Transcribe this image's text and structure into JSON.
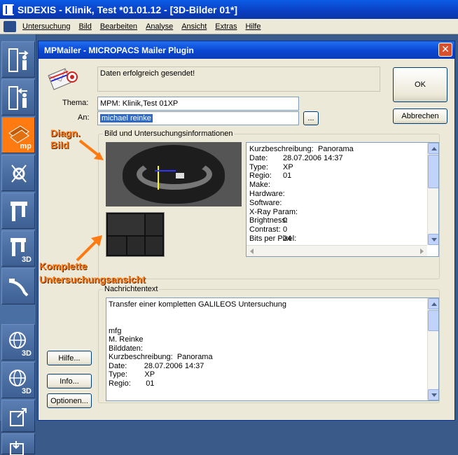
{
  "app": {
    "title": "SIDEXIS - Klinik, Test *01.01.12 - [3D-Bilder 01*]"
  },
  "menu": [
    "Untersuchung",
    "Bild",
    "Bearbeiten",
    "Analyse",
    "Ansicht",
    "Extras",
    "Hilfe"
  ],
  "toolbar": {
    "items": [
      {
        "icon": "door-exit-person-icon",
        "sub": ""
      },
      {
        "icon": "door-enter-person-icon",
        "sub": ""
      },
      {
        "icon": "mpmailer-icon",
        "sub": "mp"
      },
      {
        "icon": "tooth-measure-icon",
        "sub": ""
      },
      {
        "icon": "xray-unit-icon",
        "sub": ""
      },
      {
        "icon": "xray-unit-3d-icon",
        "sub": "3D"
      },
      {
        "icon": "intraoral-sensor-icon",
        "sub": ""
      },
      {
        "icon": "globe-3d-icon",
        "sub": "3D"
      },
      {
        "icon": "globe-3d-alt-icon",
        "sub": "3D"
      },
      {
        "icon": "export-icon",
        "sub": ""
      },
      {
        "icon": "import-icon",
        "sub": ""
      }
    ],
    "active_color": "#ff7a10"
  },
  "dialog": {
    "title": "MPMailer - MICROPACS Mailer Plugin",
    "status": "Daten erfolgreich gesendet!",
    "ok_label": "OK",
    "cancel_label": "Abbrechen",
    "thema_label": "Thema:",
    "thema_value": "MPM: Klinik,Test 01XP",
    "an_label": "An:",
    "an_value": "michael reinke",
    "browse_label": "...",
    "group_images_title": "Bild und Untersuchungsinformationen",
    "info": [
      {
        "k": "Kurzbeschreibung:",
        "v": "Panorama"
      },
      {
        "k": "Date:",
        "v": "28.07.2006 14:37"
      },
      {
        "k": "Type:",
        "v": "XP"
      },
      {
        "k": "Regio:",
        "v": "01"
      },
      {
        "k": "Make:",
        "v": ""
      },
      {
        "k": "Hardware:",
        "v": ""
      },
      {
        "k": "Software:",
        "v": ""
      },
      {
        "k": "X-Ray Param:",
        "v": ""
      },
      {
        "k": "Brightness:",
        "v": "0"
      },
      {
        "k": "Contrast:",
        "v": "0"
      },
      {
        "k": "Bits per Pixel:",
        "v": "24"
      }
    ],
    "group_message_title": "Nachrichtentext",
    "message_lines": [
      "Transfer einer kompletten GALILEOS Untersuchung",
      "",
      "",
      "mfg",
      "M. Reinke",
      "Bilddaten:",
      "Kurzbeschreibung:  Panorama",
      "Date:        28.07.2006 14:37",
      "Type:        XP",
      "Regio:       01"
    ],
    "help_label": "Hilfe...",
    "info_label": "Info...",
    "options_label": "Optionen..."
  },
  "annotations": {
    "diagn": [
      "Diagn.",
      "Bild"
    ],
    "komplette": [
      "Komplette",
      "Untersuchungsansicht"
    ],
    "color": "#ff7a10"
  }
}
